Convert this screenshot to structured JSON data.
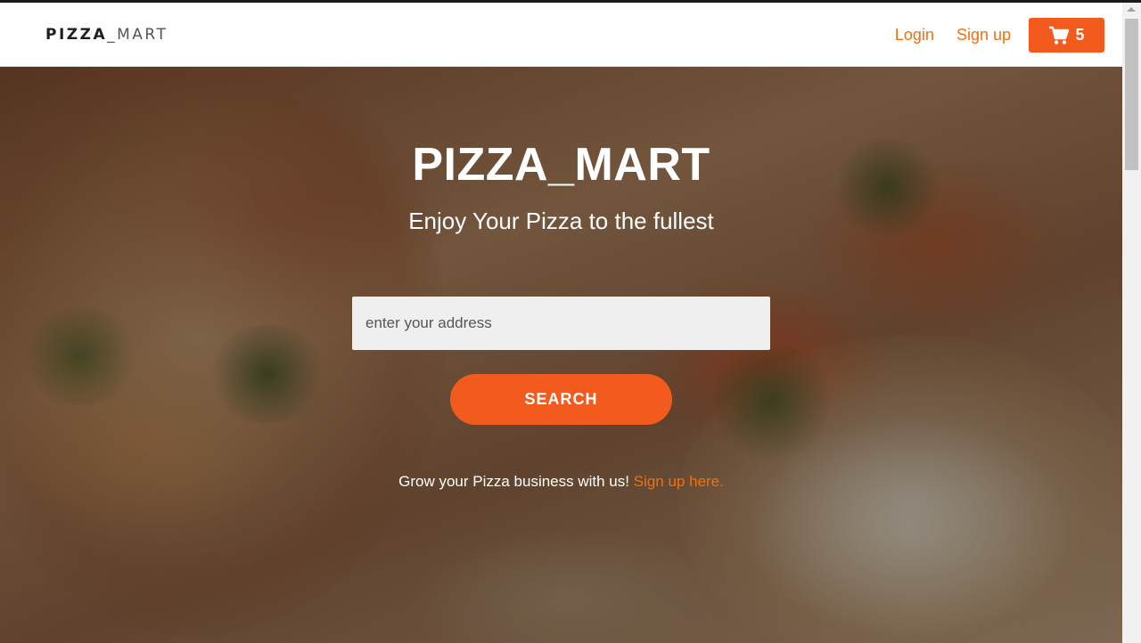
{
  "brand": {
    "part1": "PIZZA",
    "part2": "_MART"
  },
  "nav": {
    "login": "Login",
    "signup": "Sign up",
    "cart_count": "5",
    "cart_icon": "shopping-cart-icon"
  },
  "hero": {
    "title": "PIZZA_MART",
    "subtitle": "Enjoy Your Pizza to the fullest",
    "address_placeholder": "enter your address",
    "search_label": "SEARCH",
    "promo_text": "Grow your Pizza business with us!",
    "promo_link": "Sign up here."
  },
  "colors": {
    "accent": "#f25b1d",
    "link": "#f2700f"
  }
}
